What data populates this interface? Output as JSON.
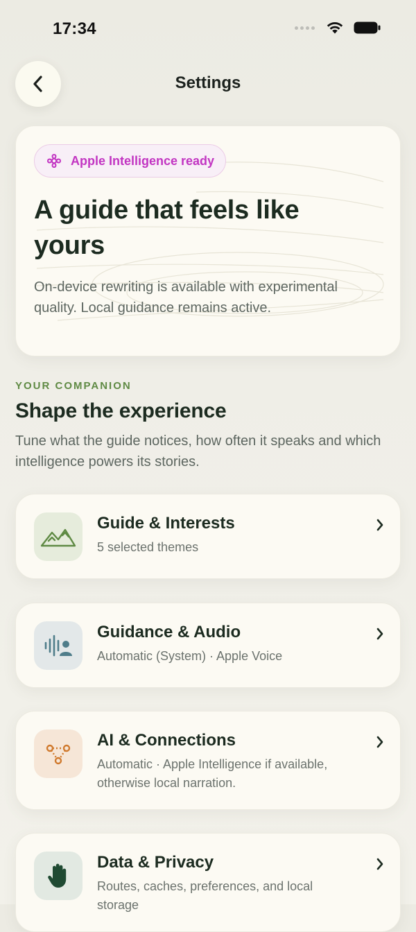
{
  "status_bar": {
    "time": "17:34",
    "icons": [
      "signal-dots-icon",
      "wifi-icon",
      "battery-icon"
    ]
  },
  "nav": {
    "title": "Settings",
    "back_icon": "chevron-left-icon"
  },
  "hero": {
    "badge_icon": "apple-intelligence-icon",
    "badge_label": "Apple Intelligence ready",
    "title": "A guide that feels like yours",
    "description": "On-device rewriting is available with experimental quality. Local guidance remains active."
  },
  "section": {
    "eyebrow": "YOUR COMPANION",
    "title": "Shape the experience",
    "description": "Tune what the guide notices, how often it speaks and which intelligence powers its stories."
  },
  "settings_items": [
    {
      "title": "Guide & Interests",
      "subtitle": "5 selected themes",
      "icon": "mountains-icon",
      "icon_bg": "#e6ecdc",
      "icon_color": "#5f8a44"
    },
    {
      "title": "Guidance & Audio",
      "subtitle": "Automatic (System) · Apple Voice",
      "icon": "voice-waveform-icon",
      "icon_bg": "#e3e8e9",
      "icon_color": "#4f7d8a"
    },
    {
      "title": "AI & Connections",
      "subtitle": "Automatic · Apple Intelligence if available, otherwise local narration.",
      "icon": "connections-icon",
      "icon_bg": "#f6e6d7",
      "icon_color": "#d07a2e"
    },
    {
      "title": "Data & Privacy",
      "subtitle": "Routes, caches, preferences, and local storage",
      "icon": "hand-icon",
      "icon_bg": "#e2e9e2",
      "icon_color": "#1f4a32"
    }
  ],
  "colors": {
    "background": "#efeee7",
    "card": "#fcfaf3",
    "accent_green": "#5f8a44",
    "badge_pink": "#c235c2",
    "text_dark": "#1c2b20",
    "text_muted": "#5d6660"
  }
}
